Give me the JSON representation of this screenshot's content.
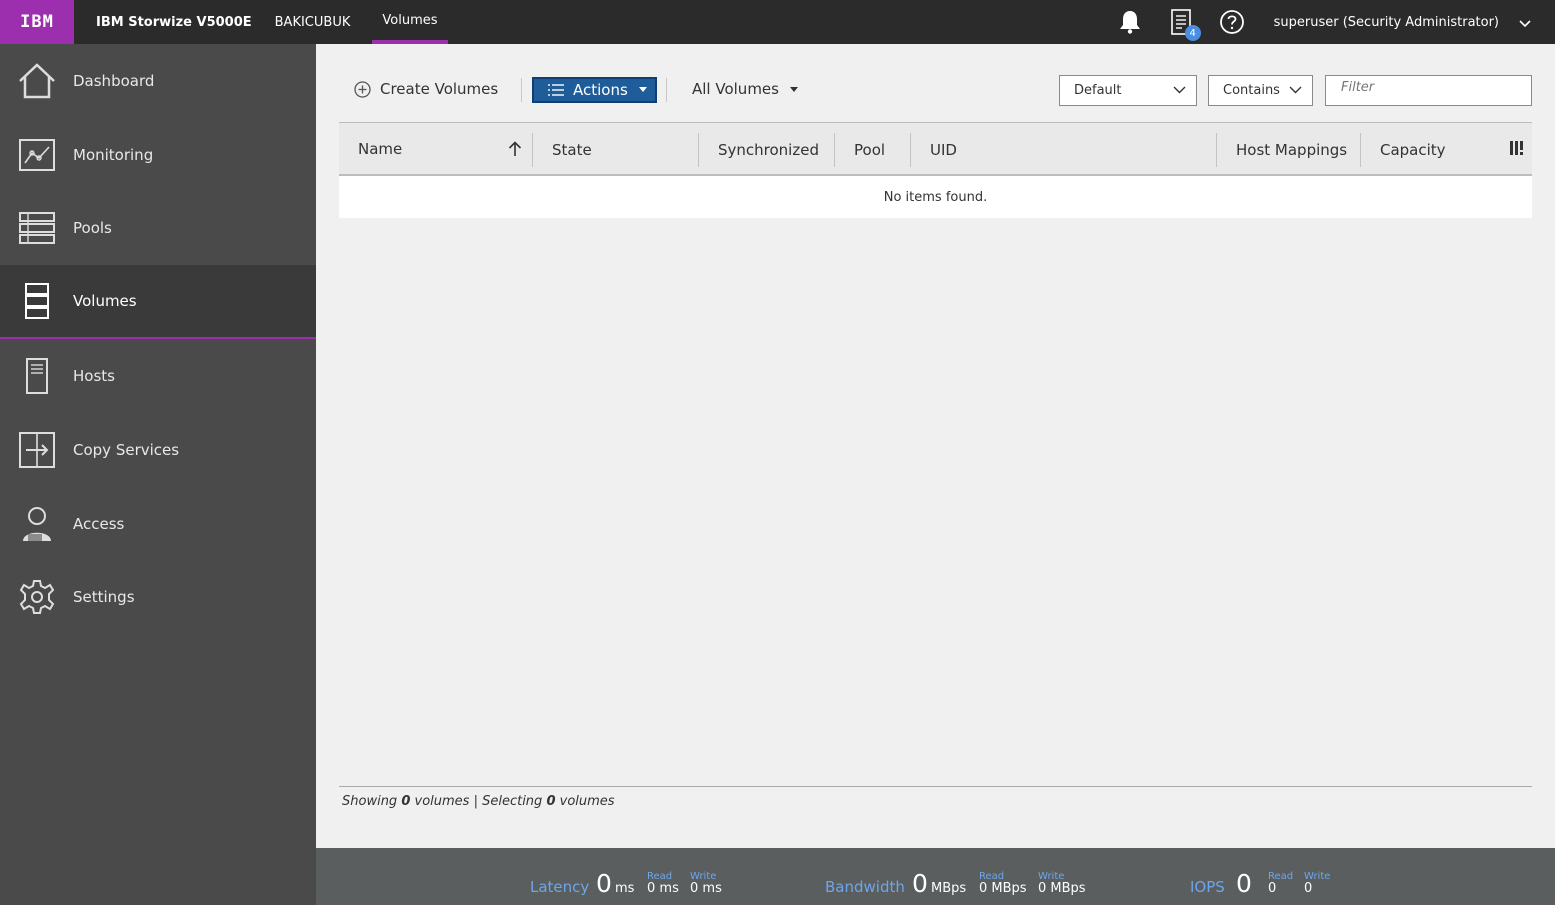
{
  "header": {
    "logo": "IBM",
    "product": "IBM Storwize V5000E",
    "system_name": "BAKICUBUK",
    "page_tab": "Volumes",
    "tasks_badge": "4",
    "user": "superuser (Security Administrator)"
  },
  "sidebar": {
    "items": [
      {
        "label": "Dashboard",
        "icon": "home-icon"
      },
      {
        "label": "Monitoring",
        "icon": "monitoring-icon"
      },
      {
        "label": "Pools",
        "icon": "pools-icon"
      },
      {
        "label": "Volumes",
        "icon": "volumes-icon",
        "active": true
      },
      {
        "label": "Hosts",
        "icon": "hosts-icon"
      },
      {
        "label": "Copy Services",
        "icon": "copy-services-icon"
      },
      {
        "label": "Access",
        "icon": "access-icon"
      },
      {
        "label": "Settings",
        "icon": "gear-icon"
      }
    ]
  },
  "toolbar": {
    "create_label": "Create Volumes",
    "actions_label": "Actions",
    "view_label": "All Volumes",
    "filter_scope": "Default",
    "filter_mode": "Contains",
    "filter_placeholder": "Filter"
  },
  "table": {
    "columns": [
      "Name",
      "State",
      "Synchronized",
      "Pool",
      "UID",
      "Host Mappings",
      "Capacity"
    ],
    "empty_message": "No items found."
  },
  "status": {
    "showing_prefix": "Showing",
    "showing_count": "0",
    "showing_mid": "volumes | Selecting",
    "selecting_count": "0",
    "showing_suffix": "volumes"
  },
  "performance": {
    "latency": {
      "title": "Latency",
      "value": "0",
      "unit": "ms",
      "read_label": "Read",
      "read_value": "0 ms",
      "write_label": "Write",
      "write_value": "0 ms"
    },
    "bandwidth": {
      "title": "Bandwidth",
      "value": "0",
      "unit": "MBps",
      "read_label": "Read",
      "read_value": "0 MBps",
      "write_label": "Write",
      "write_value": "0 MBps"
    },
    "iops": {
      "title": "IOPS",
      "value": "0",
      "read_label": "Read",
      "read_value": "0",
      "write_label": "Write",
      "write_value": "0"
    }
  },
  "colors": {
    "brand": "#9b2fae",
    "actions_button": "#1f5d9a",
    "sidebar": "#4a4a4a",
    "topbar": "#2b2b2b",
    "perf_label": "#6ea6ea"
  }
}
